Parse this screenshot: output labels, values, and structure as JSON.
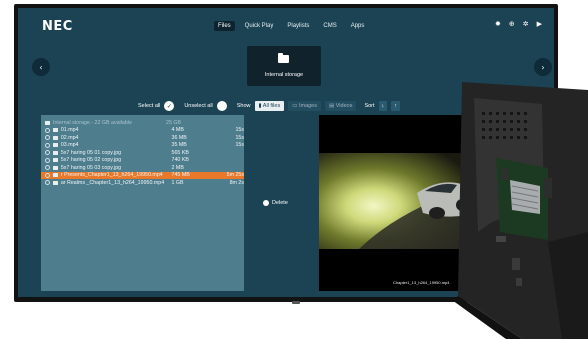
{
  "header": {
    "logo": "NEC",
    "nav": [
      {
        "label": "Files",
        "active": true
      },
      {
        "label": "Quick Play",
        "active": false
      },
      {
        "label": "Playlists",
        "active": false
      },
      {
        "label": "CMS",
        "active": false
      },
      {
        "label": "Apps",
        "active": false
      }
    ],
    "icons": [
      "settings-icon",
      "network-icon",
      "gear-icon",
      "play-icon"
    ]
  },
  "storage": {
    "label": "Internal storage",
    "icon": "folder-icon"
  },
  "toolbar": {
    "select_all": "Select all",
    "unselect_all": "Unselect all",
    "show": "Show",
    "filters": [
      {
        "label": "All files",
        "active": true
      },
      {
        "label": "Images",
        "active": false
      },
      {
        "label": "Videos",
        "active": false
      }
    ],
    "sort": "Sort"
  },
  "files": {
    "summary": "Internal storage - 22 GB available",
    "summary_size": "25 GB",
    "items": [
      {
        "name": "01.mp4",
        "size": "4 MB",
        "duration": "15s",
        "selected": false
      },
      {
        "name": "02.mp4",
        "size": "36 MB",
        "duration": "15s",
        "selected": false
      },
      {
        "name": "03.mp4",
        "size": "35 MB",
        "duration": "15s",
        "selected": false
      },
      {
        "name": "5x7 haring 05 01 copy.jpg",
        "size": "565 KB",
        "duration": "",
        "selected": false
      },
      {
        "name": "5x7 haring 05 02 copy.jpg",
        "size": "740 KB",
        "duration": "",
        "selected": false
      },
      {
        "name": "5x7 haring 05 03 copy.jpg",
        "size": "2 MB",
        "duration": "",
        "selected": false
      },
      {
        "name": "r Presents_Chapter1_13_h264_19950.mp4",
        "size": "745 MB",
        "duration": "5m 25s",
        "selected": true
      },
      {
        "name": "ar Realms _Chapter1_13_h264_19950.mp4",
        "size": "1 GB",
        "duration": "8m 2s",
        "selected": false
      }
    ]
  },
  "actions": {
    "delete": "Delete"
  },
  "preview": {
    "caption": "Chapter1_13_h264_19950.mp4"
  },
  "colors": {
    "screen_bg": "#1b4354",
    "panel_bg": "#4e7d8d",
    "selected": "#e8792b"
  }
}
